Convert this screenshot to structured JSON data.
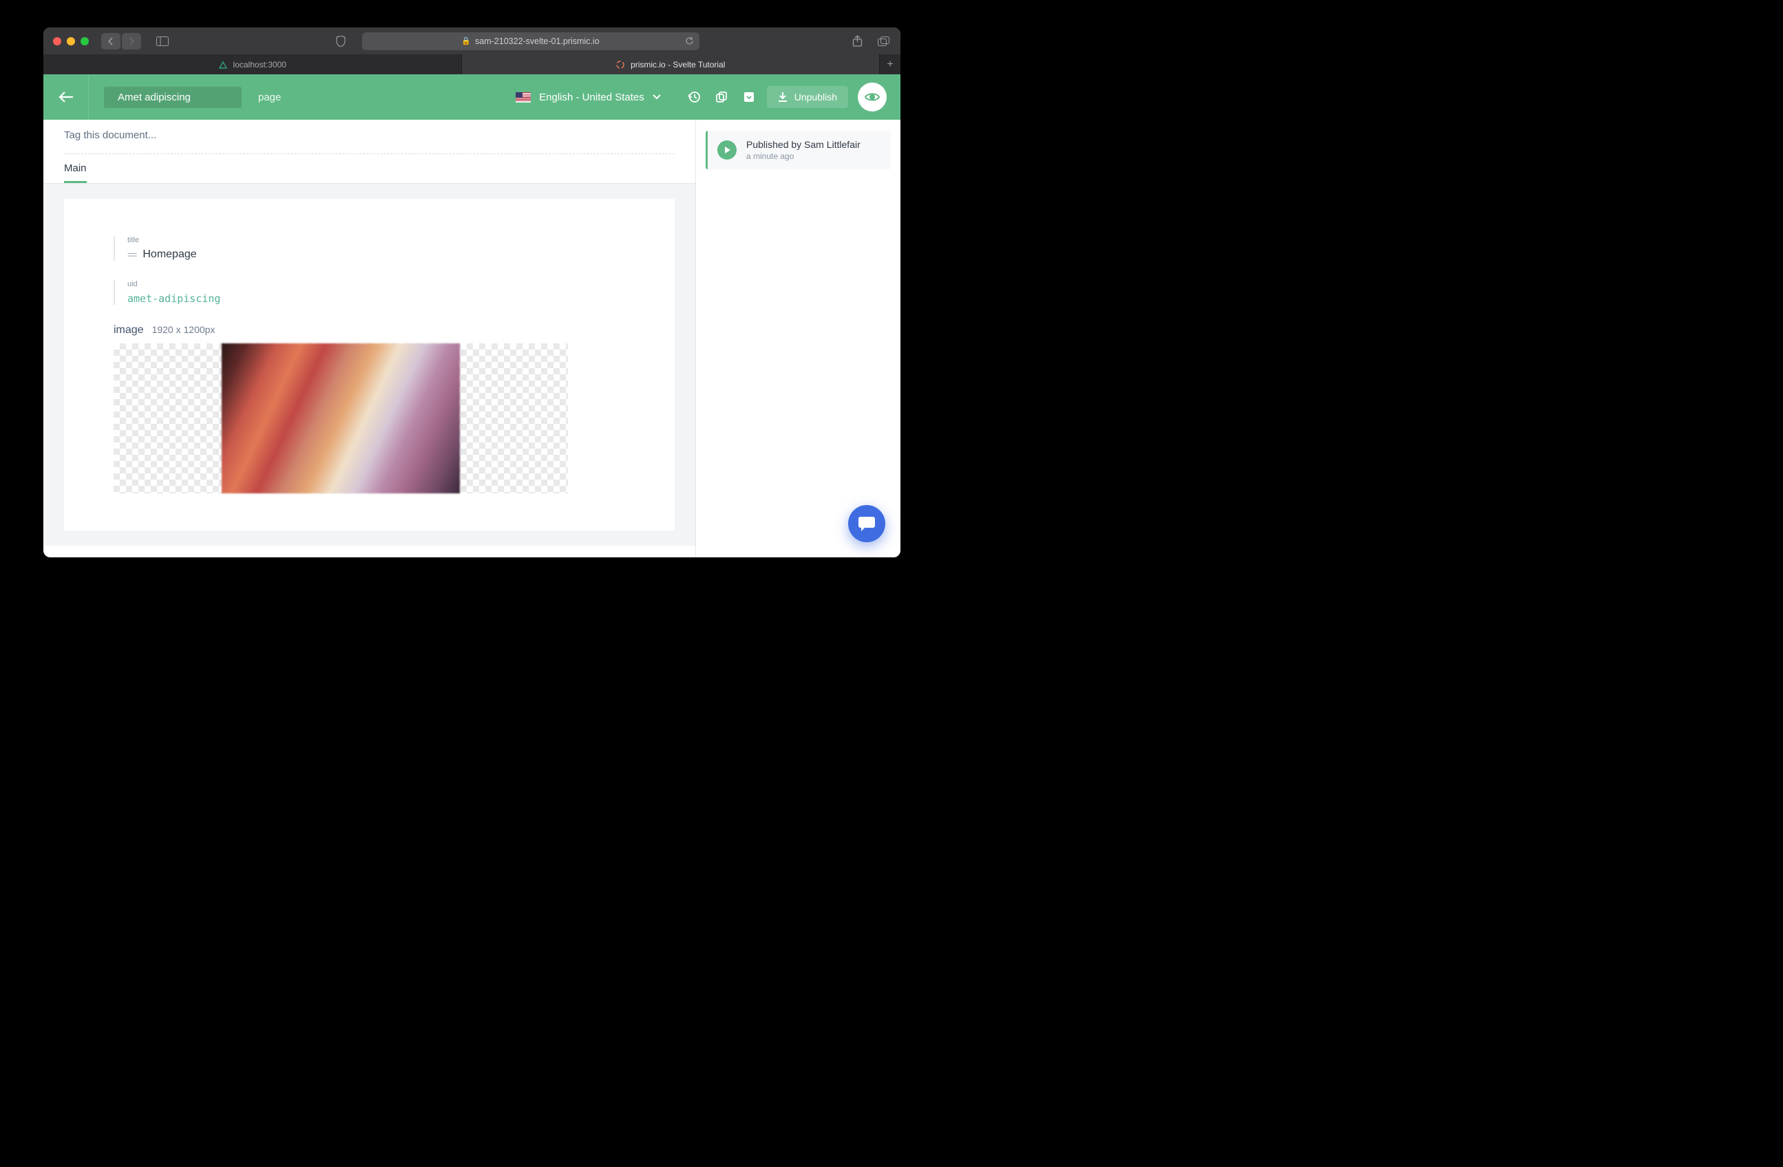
{
  "browser": {
    "address": "sam-210322-svelte-01.prismic.io",
    "tabs": [
      {
        "label": "localhost:3000",
        "active": false
      },
      {
        "label": "prismic.io - Svelte Tutorial",
        "active": true
      }
    ]
  },
  "header": {
    "doc_title": "Amet adipiscing",
    "doc_type": "page",
    "locale": "English - United States",
    "unpublish_label": "Unpublish"
  },
  "tags_placeholder": "Tag this document...",
  "content_tabs": {
    "main": "Main"
  },
  "fields": {
    "title_label": "title",
    "title_value": "Homepage",
    "uid_label": "uid",
    "uid_value": "amet-adipiscing",
    "image_label": "image",
    "image_dims": "1920 x 1200px"
  },
  "sidebar": {
    "status_line": "Published by Sam Littlefair",
    "status_time": "a minute ago"
  }
}
